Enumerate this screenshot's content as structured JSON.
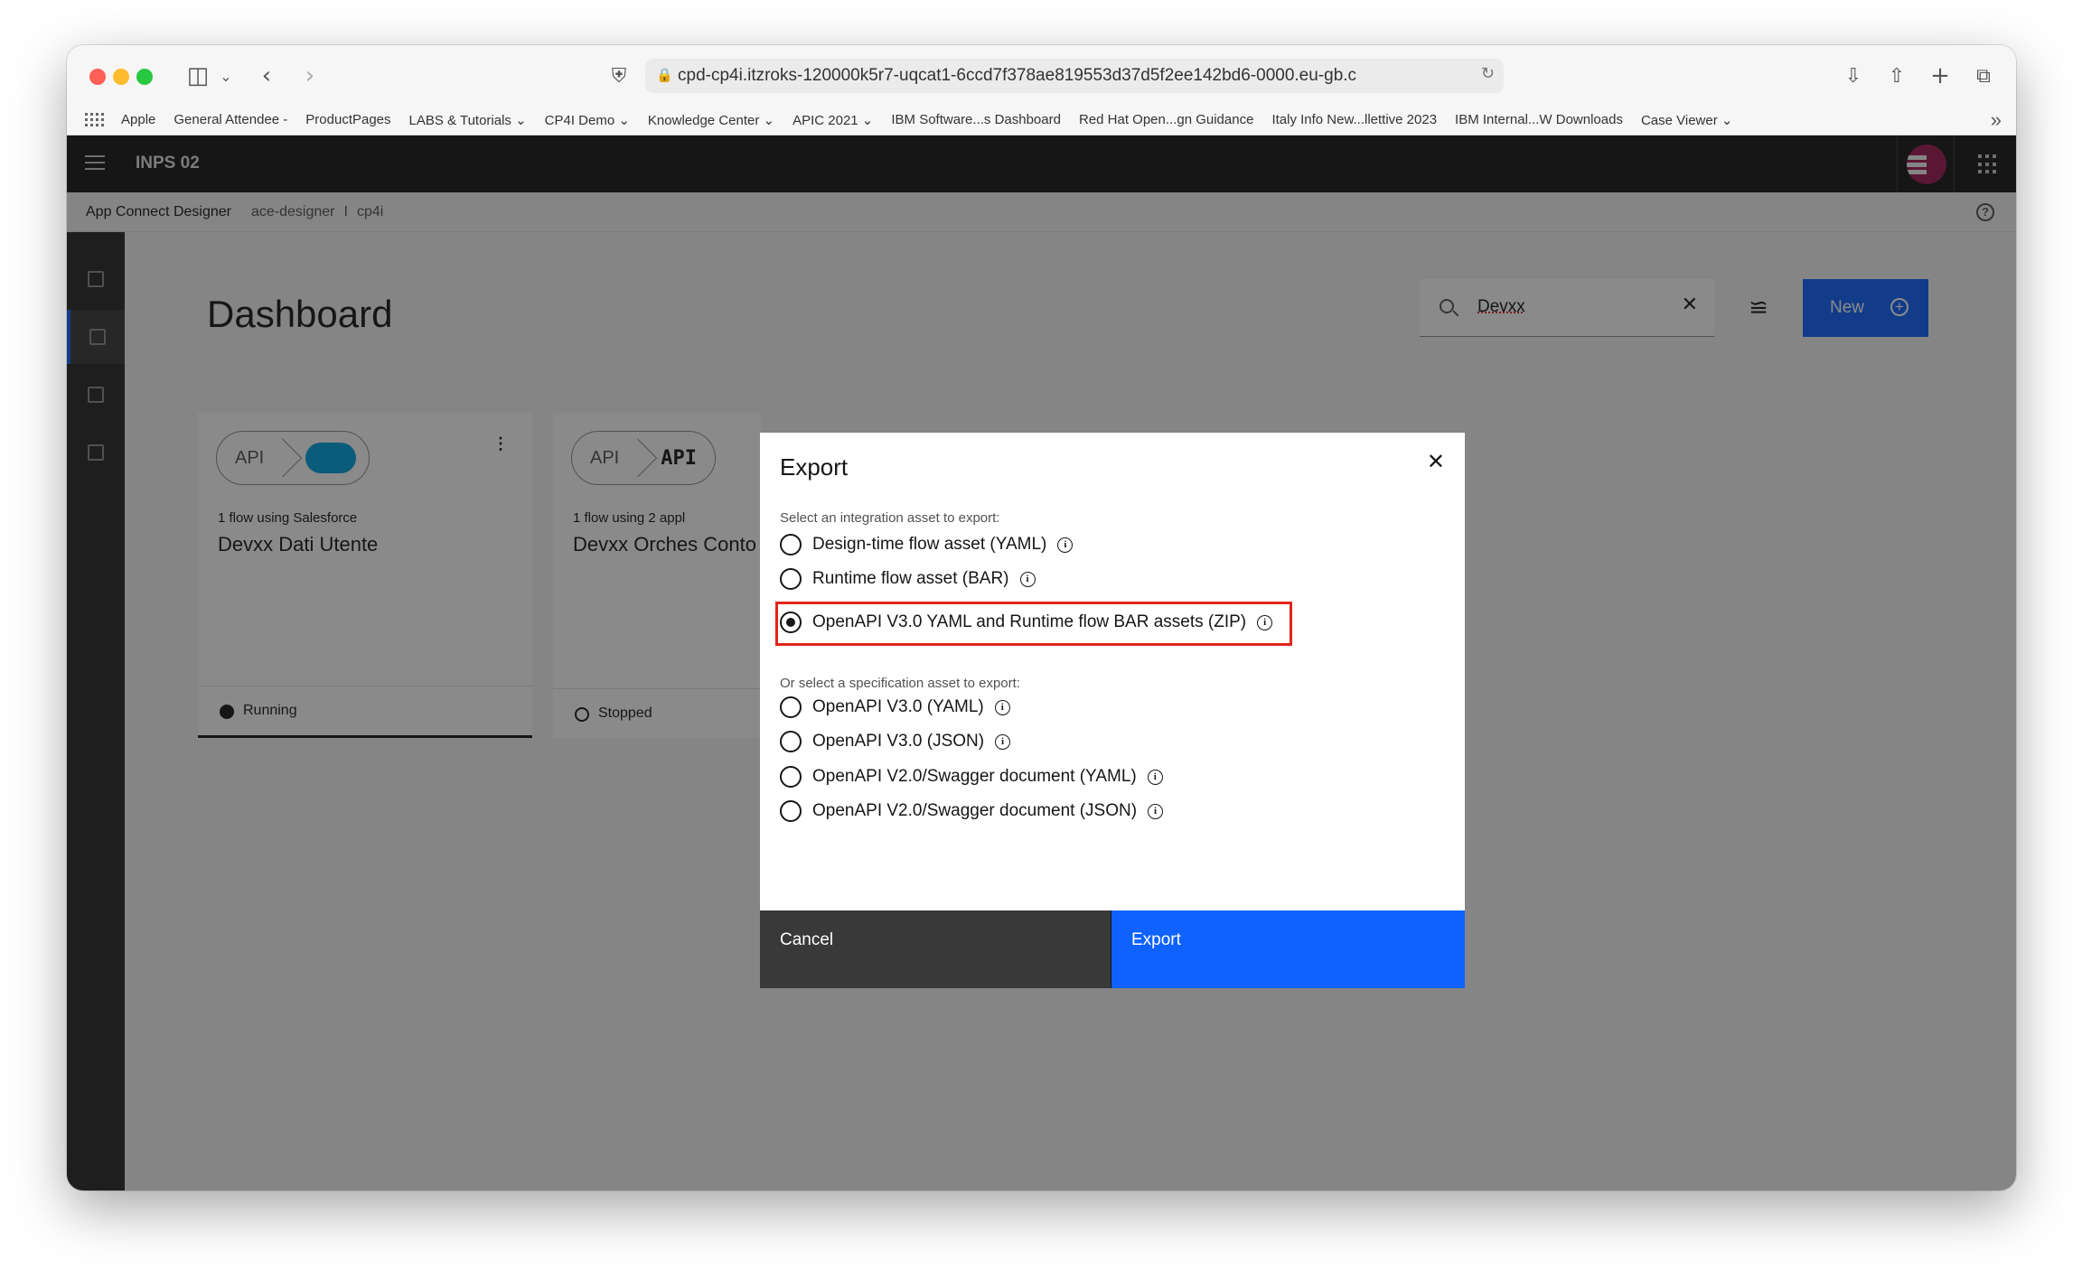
{
  "browser": {
    "url": "cpd-cp4i.itzroks-120000k5r7-uqcat1-6ccd7f378ae819553d37d5f2ee142bd6-0000.eu-gb.c",
    "bookmarks": [
      "Apple",
      "General Attendee -",
      "ProductPages",
      "LABS & Tutorials ⌄",
      "CP4I Demo ⌄",
      "Knowledge Center ⌄",
      "APIC 2021 ⌄",
      "IBM Software...s Dashboard",
      "Red Hat Open...gn Guidance",
      "Italy Info New...llettive 2023",
      "IBM Internal...W Downloads",
      "Case Viewer ⌄"
    ]
  },
  "header": {
    "title": "INPS 02"
  },
  "breadcrumb": {
    "app": "App Connect Designer",
    "instance": "ace-designer",
    "separator": "I",
    "namespace": "cp4i"
  },
  "dashboard": {
    "title": "Dashboard",
    "search_value": "Devxx",
    "new_label": "New",
    "cards": [
      {
        "pill_label": "API",
        "subtitle": "1 flow using Salesforce",
        "name": "Devxx Dati Utente",
        "status": "Running"
      },
      {
        "pill_label": "API",
        "pill_label_2": "API",
        "subtitle": "1 flow using 2 appl",
        "name": "Devxx Orches Conto",
        "status": "Stopped"
      }
    ]
  },
  "modal": {
    "title": "Export",
    "integration_label": "Select an integration asset to export:",
    "integration_options": [
      "Design-time flow asset (YAML)",
      "Runtime flow asset (BAR)",
      "OpenAPI V3.0 YAML and Runtime flow BAR assets (ZIP)"
    ],
    "spec_label": "Or select a specification asset to export:",
    "spec_options": [
      "OpenAPI V3.0 (YAML)",
      "OpenAPI V3.0 (JSON)",
      "OpenAPI V2.0/Swagger document (YAML)",
      "OpenAPI V2.0/Swagger document (JSON)"
    ],
    "selected": "OpenAPI V3.0 YAML and Runtime flow BAR assets (ZIP)",
    "cancel_label": "Cancel",
    "export_label": "Export"
  },
  "colors": {
    "primary": "#0f62fe",
    "highlight": "#e0261a",
    "header_bg": "#161616"
  }
}
